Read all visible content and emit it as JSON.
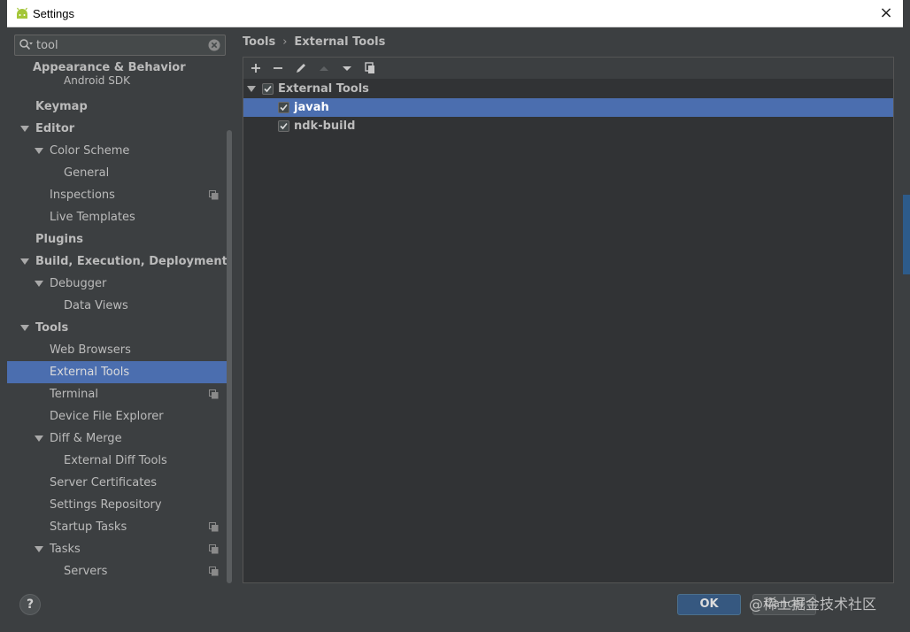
{
  "window": {
    "title": "Settings",
    "close_glyph": "×"
  },
  "search": {
    "value": "tool",
    "placeholder": ""
  },
  "nav": [
    {
      "label": "Appearance & Behavior",
      "bold": true,
      "level": 0,
      "arrow": false
    },
    {
      "label": "Android SDK",
      "bold": false,
      "level": 3,
      "arrow": false
    },
    {
      "label": "Keymap",
      "bold": true,
      "level": 0,
      "arrow": false
    },
    {
      "label": "Editor",
      "bold": true,
      "level": 0,
      "arrow": true
    },
    {
      "label": "Color Scheme",
      "bold": false,
      "level": 1,
      "arrow": true
    },
    {
      "label": "General",
      "bold": false,
      "level": 2,
      "arrow": false
    },
    {
      "label": "Inspections",
      "bold": false,
      "level": 1,
      "arrow": false,
      "project_icon": true
    },
    {
      "label": "Live Templates",
      "bold": false,
      "level": 1,
      "arrow": false
    },
    {
      "label": "Plugins",
      "bold": true,
      "level": 0,
      "arrow": false
    },
    {
      "label": "Build, Execution, Deployment",
      "bold": true,
      "level": 0,
      "arrow": true
    },
    {
      "label": "Debugger",
      "bold": false,
      "level": 1,
      "arrow": true
    },
    {
      "label": "Data Views",
      "bold": false,
      "level": 2,
      "arrow": false
    },
    {
      "label": "Tools",
      "bold": true,
      "level": 0,
      "arrow": true
    },
    {
      "label": "Web Browsers",
      "bold": false,
      "level": 1,
      "arrow": false
    },
    {
      "label": "External Tools",
      "bold": false,
      "level": 1,
      "arrow": false,
      "selected": true
    },
    {
      "label": "Terminal",
      "bold": false,
      "level": 1,
      "arrow": false,
      "project_icon": true
    },
    {
      "label": "Device File Explorer",
      "bold": false,
      "level": 1,
      "arrow": false
    },
    {
      "label": "Diff & Merge",
      "bold": false,
      "level": 1,
      "arrow": true
    },
    {
      "label": "External Diff Tools",
      "bold": false,
      "level": 2,
      "arrow": false
    },
    {
      "label": "Server Certificates",
      "bold": false,
      "level": 1,
      "arrow": false
    },
    {
      "label": "Settings Repository",
      "bold": false,
      "level": 1,
      "arrow": false
    },
    {
      "label": "Startup Tasks",
      "bold": false,
      "level": 1,
      "arrow": false,
      "project_icon": true
    },
    {
      "label": "Tasks",
      "bold": false,
      "level": 1,
      "arrow": true,
      "project_icon": true
    },
    {
      "label": "Servers",
      "bold": false,
      "level": 2,
      "arrow": false,
      "project_icon": true
    }
  ],
  "breadcrumb": {
    "parent": "Tools",
    "separator": "›",
    "current": "External Tools"
  },
  "toolbar": {
    "icons": [
      "add-icon",
      "remove-icon",
      "edit-icon",
      "move-up-icon",
      "move-down-icon",
      "copy-icon"
    ]
  },
  "tools_tree": {
    "group": {
      "label": "External Tools",
      "checked": true
    },
    "items": [
      {
        "label": "javah",
        "checked": true,
        "selected": true
      },
      {
        "label": "ndk-build",
        "checked": true,
        "selected": false
      }
    ]
  },
  "footer": {
    "help_label": "?",
    "ok_label": "OK",
    "cancel_label": "Cancel",
    "watermark": "@稀土掘金技术社区"
  },
  "colors": {
    "background": "#3c3f41",
    "list_background": "#313335",
    "selection": "#4b6eaf",
    "ok_button": "#365880",
    "text": "#bbbbbb"
  }
}
